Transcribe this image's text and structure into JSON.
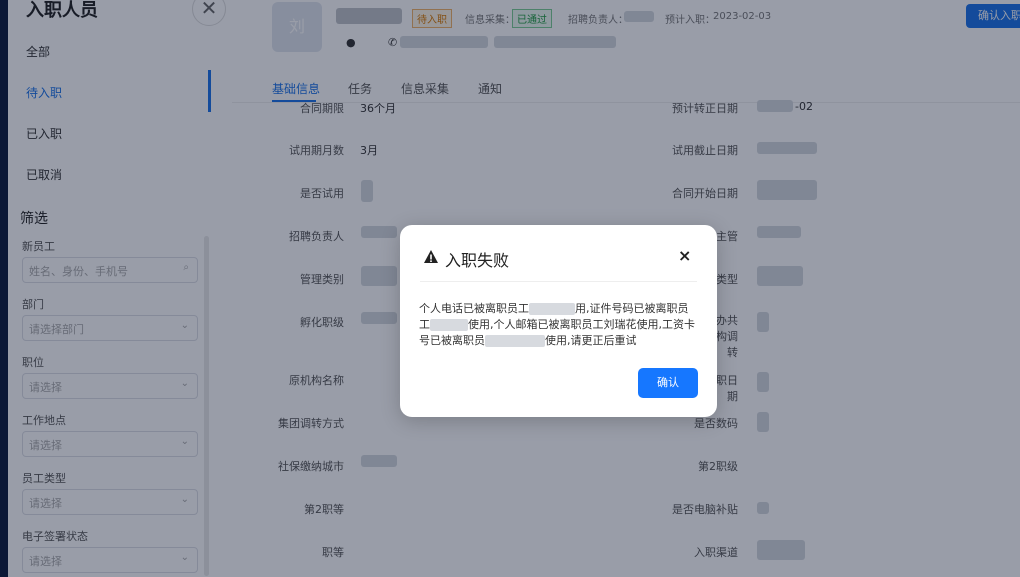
{
  "sidebar": {
    "title": "入职人员",
    "close": "✕",
    "tabs": [
      "全部",
      "待入职",
      "已入职",
      "已取消"
    ],
    "filter_title": "筛选",
    "fields": [
      {
        "label": "新员工",
        "placeholder": "姓名、身份、手机号",
        "icon": "search-icon"
      },
      {
        "label": "部门",
        "placeholder": "请选择部门"
      },
      {
        "label": "职位",
        "placeholder": "请选择"
      },
      {
        "label": "工作地点",
        "placeholder": "请选择"
      },
      {
        "label": "员工类型",
        "placeholder": "请选择"
      },
      {
        "label": "电子签署状态",
        "placeholder": "请选择"
      }
    ]
  },
  "header": {
    "avatar_text": "刘",
    "status_badge": "待入职",
    "info_collect_label": "信息采集：",
    "info_collect_badge": "已通过",
    "recruiter_label": "招聘负责人：",
    "expected_label": "预计入职：",
    "expected_date": "2023-02-03",
    "confirm_button": "确认入职"
  },
  "tabs": [
    "基础信息",
    "任务",
    "信息采集",
    "通知"
  ],
  "form": {
    "left": [
      {
        "label": "合同期限",
        "value": "36个月"
      },
      {
        "label": "试用期月数",
        "value": "3月"
      },
      {
        "label": "是否试用",
        "value": ""
      },
      {
        "label": "招聘负责人",
        "value": ""
      },
      {
        "label": "管理类别",
        "value": ""
      },
      {
        "label": "孵化职级",
        "value": ""
      },
      {
        "label": "原机构名称",
        "value": ""
      },
      {
        "label": "集团调转方式",
        "value": ""
      },
      {
        "label": "社保缴纳城市",
        "value": ""
      },
      {
        "label": "第2职等",
        "value": ""
      },
      {
        "label": "职等",
        "value": ""
      }
    ],
    "right": [
      {
        "label": "预计转正日期",
        "value": "-02"
      },
      {
        "label": "试用截止日期",
        "value": ""
      },
      {
        "label": "合同开始日期",
        "value": ""
      },
      {
        "label": "主管",
        "value": ""
      },
      {
        "label": "类型",
        "value": ""
      },
      {
        "label": "办共",
        "value": ""
      },
      {
        "label": "构调",
        "value": ""
      },
      {
        "label": "转",
        "value": ""
      },
      {
        "label": "职日",
        "value": ""
      },
      {
        "label": "期",
        "value": ""
      },
      {
        "label": "是否数码",
        "value": ""
      },
      {
        "label": "第2职级",
        "value": ""
      },
      {
        "label": "是否电脑补贴",
        "value": ""
      },
      {
        "label": "入职渠道",
        "value": ""
      }
    ]
  },
  "modal": {
    "title": "入职失败",
    "close": "×",
    "msg_line1_a": "个人电话已被离职员工",
    "msg_line1_b": "用,证件号码已被离职员",
    "msg_line2_a": "工",
    "msg_line2_b": "使用,个人邮箱已被离职员工刘瑞花使用,工资卡",
    "msg_line3_a": "号已被离职员",
    "msg_line3_b": "使用,请更正后重试",
    "ok": "确认"
  }
}
